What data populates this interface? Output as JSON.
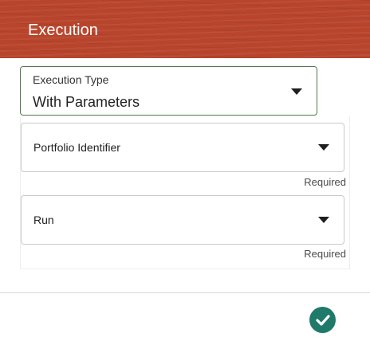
{
  "header": {
    "title": "Execution"
  },
  "execution_type": {
    "label": "Execution Type",
    "value": "With Parameters"
  },
  "parameters": [
    {
      "label": "Portfolio Identifier",
      "note": "Required"
    },
    {
      "label": "Run",
      "note": "Required"
    }
  ],
  "icons": {
    "dropdown": "chevron-down-icon",
    "confirm": "checkmark-icon"
  },
  "colors": {
    "header": "#b8442c",
    "accent_border": "#4d7a48",
    "confirm_button": "#1f7a6a"
  }
}
